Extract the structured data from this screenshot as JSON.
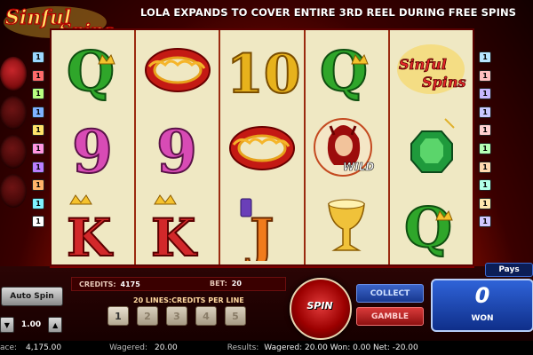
{
  "header": {
    "logo_text_1": "Sinful",
    "logo_text_2": "Spins",
    "banner": "LOLA EXPANDS TO COVER ENTIRE 3RD REEL DURING FREE SPINS"
  },
  "line_markers_left": [
    {
      "n": "1",
      "color": "#9bd7ff"
    },
    {
      "n": "1",
      "color": "#ff6b6b"
    },
    {
      "n": "1",
      "color": "#b8ff80"
    },
    {
      "n": "1",
      "color": "#7fb2ff"
    },
    {
      "n": "1",
      "color": "#ffe36a"
    },
    {
      "n": "1",
      "color": "#ff96e0"
    },
    {
      "n": "1",
      "color": "#b97fff"
    },
    {
      "n": "1",
      "color": "#ffb36a"
    },
    {
      "n": "1",
      "color": "#7ff2ff"
    },
    {
      "n": "1",
      "color": "#ffffff"
    }
  ],
  "line_markers_right": [
    {
      "n": "1",
      "color": "#b9e5ff"
    },
    {
      "n": "1",
      "color": "#ffc0c0"
    },
    {
      "n": "1",
      "color": "#c7b8ff"
    },
    {
      "n": "1",
      "color": "#c9c9ff"
    },
    {
      "n": "1",
      "color": "#ffd0d0"
    },
    {
      "n": "1",
      "color": "#b6ffb6"
    },
    {
      "n": "1",
      "color": "#ffd9b0"
    },
    {
      "n": "1",
      "color": "#b2ffe8"
    },
    {
      "n": "1",
      "color": "#ffe8b0"
    },
    {
      "n": "1",
      "color": "#d0c8ff"
    }
  ],
  "reels": [
    [
      "q-symbol",
      "ring-symbol",
      "k-symbol"
    ],
    [
      "ring-symbol",
      "nine-symbol",
      "k-symbol"
    ],
    [
      "ten-symbol",
      "ring-symbol",
      "j-symbol"
    ],
    [
      "q-symbol",
      "lola-wild-symbol",
      "chalice-symbol"
    ],
    [
      "logo-symbol",
      "emerald-symbol",
      "q-symbol"
    ]
  ],
  "symbols": {
    "q_letter": "Q",
    "nine": "9",
    "ten": "10",
    "k_letter": "K",
    "j_letter": "J",
    "wild": "WILD",
    "logo_1": "Sinful",
    "logo_2": "Spins"
  },
  "panel": {
    "pays_label": "Pays",
    "credits_label": "CREDITS:",
    "credits_value": "4175",
    "bet_label": "BET:",
    "bet_value": "20",
    "lines_title": "20 LINES:CREDITS PER LINE",
    "line_buttons": [
      "1",
      "2",
      "3",
      "4",
      "5"
    ],
    "auto_spin": "Auto Spin",
    "credit_value": "1.00",
    "spin": "SPIN",
    "collect": "COLLECT",
    "gamble": "GAMBLE",
    "won_value": "0",
    "won_label": "WON"
  },
  "status": {
    "balance_label": "ace:",
    "balance_value": "4,175.00",
    "wagered_label": "Wagered:",
    "wagered_value": "20.00",
    "results_label": "Results:",
    "results_text": "Wagered: 20.00  Won: 0.00  Net: -20.00"
  },
  "colors": {
    "accent": "#1e46b8",
    "frame": "#5a0000",
    "reel_bg": "#efe8c3"
  }
}
